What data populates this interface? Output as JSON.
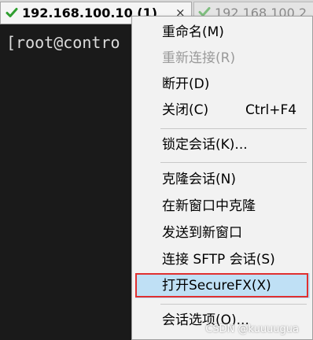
{
  "tabs": [
    {
      "title": "192.168.100.10 (1)",
      "active": true,
      "status_icon": "check-icon",
      "close_glyph": "×"
    },
    {
      "title": "192.168.100.2",
      "active": false,
      "status_icon": "check-icon"
    }
  ],
  "terminal": {
    "prompt": "[root@contro"
  },
  "context_menu": {
    "items": [
      {
        "label": "重命名(M)",
        "enabled": true
      },
      {
        "label": "重新连接(R)",
        "enabled": false
      },
      {
        "label": "断开(D)",
        "enabled": true
      },
      {
        "label": "关闭(C)",
        "shortcut": "Ctrl+F4",
        "enabled": true
      },
      {
        "label": "锁定会话(K)...",
        "enabled": true
      },
      {
        "label": "克隆会话(N)",
        "enabled": true
      },
      {
        "label": "在新窗口中克隆",
        "enabled": true
      },
      {
        "label": "发送到新窗口",
        "enabled": true
      },
      {
        "label": "连接 SFTP 会话(S)",
        "enabled": true
      },
      {
        "label": "打开SecureFX(X)",
        "enabled": true,
        "highlighted": true
      },
      {
        "label": "会话选项(O)...",
        "enabled": true
      }
    ]
  },
  "watermark": "CSDN @kuuuugua",
  "colors": {
    "highlight_bg": "#bfe0f5",
    "highlight_border": "#e03030",
    "check_green": "#2e9e2e"
  }
}
